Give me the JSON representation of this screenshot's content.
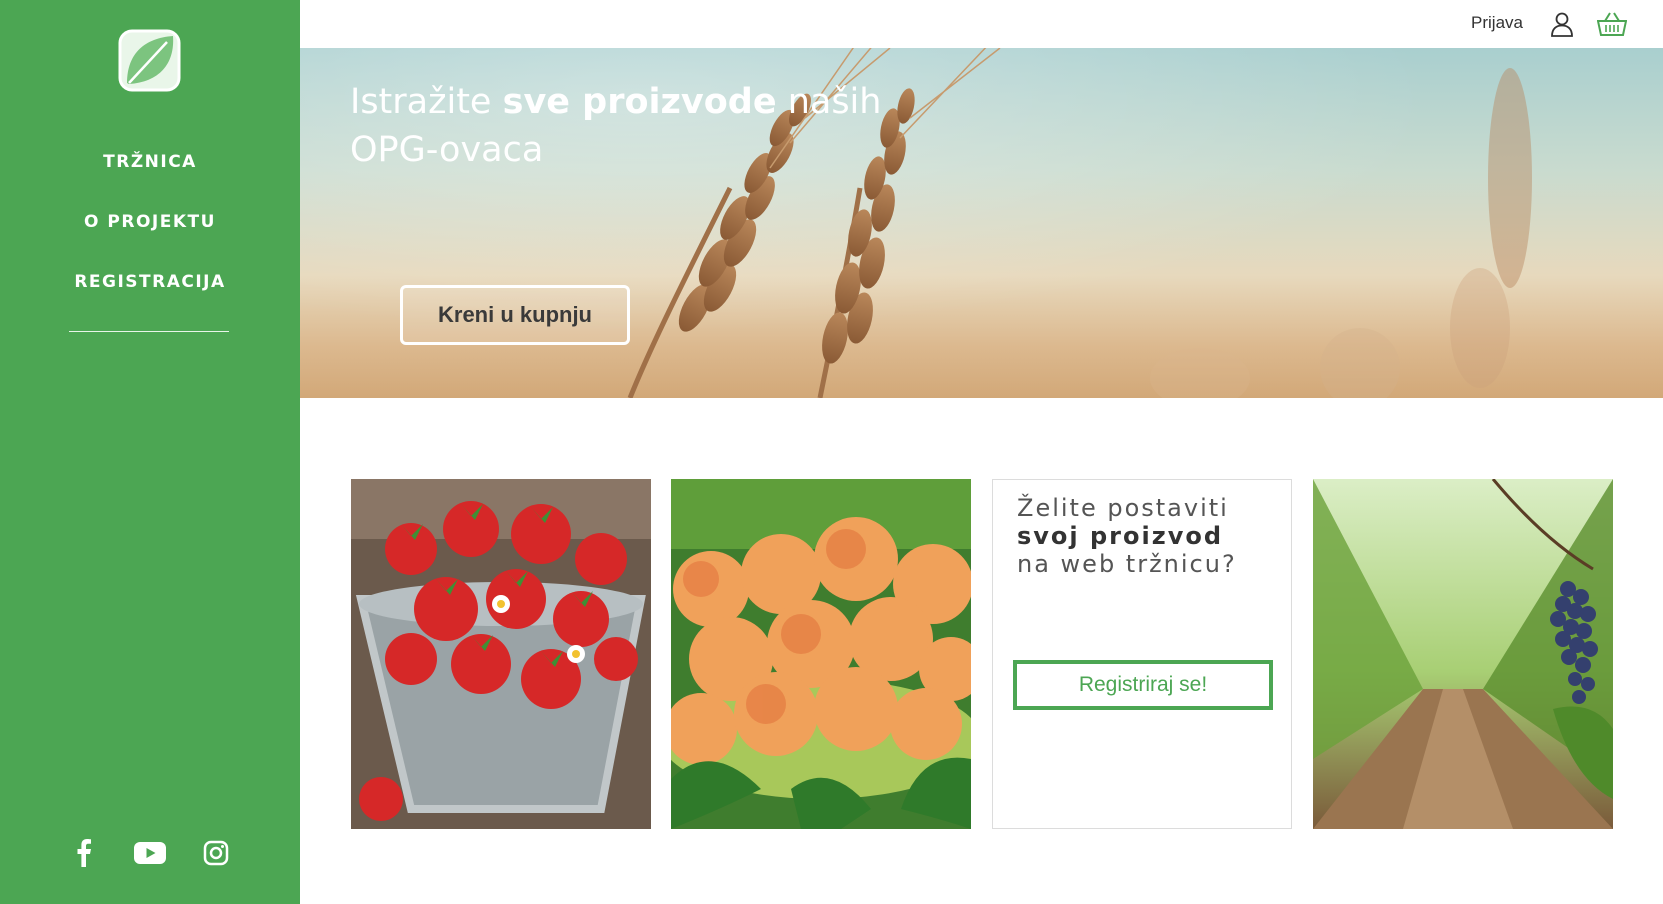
{
  "sidebar": {
    "logo_icon": "leaf-logo-icon",
    "nav": [
      "TRŽNICA",
      "O PROJEKTU",
      "REGISTRACIJA"
    ],
    "socials": [
      "facebook-icon",
      "youtube-icon",
      "instagram-icon"
    ]
  },
  "topbar": {
    "login_label": "Prijava",
    "user_icon": "user-icon",
    "cart_icon": "basket-icon"
  },
  "hero": {
    "title_part1": "Istražite ",
    "title_bold": "sve proizvode",
    "title_part2": " naših OPG-ovaca",
    "cta_label": "Kreni u kupnju"
  },
  "cards": {
    "promo_line1": "Želite postaviti ",
    "promo_bold": "svoj proizvod",
    "promo_line2": "na web tržnicu?",
    "promo_button": "Registriraj se!",
    "images": [
      "strawberries-photo",
      "apricots-photo",
      "vineyard-grapes-photo"
    ]
  },
  "colors": {
    "brand_green": "#4ca653",
    "white": "#ffffff"
  }
}
